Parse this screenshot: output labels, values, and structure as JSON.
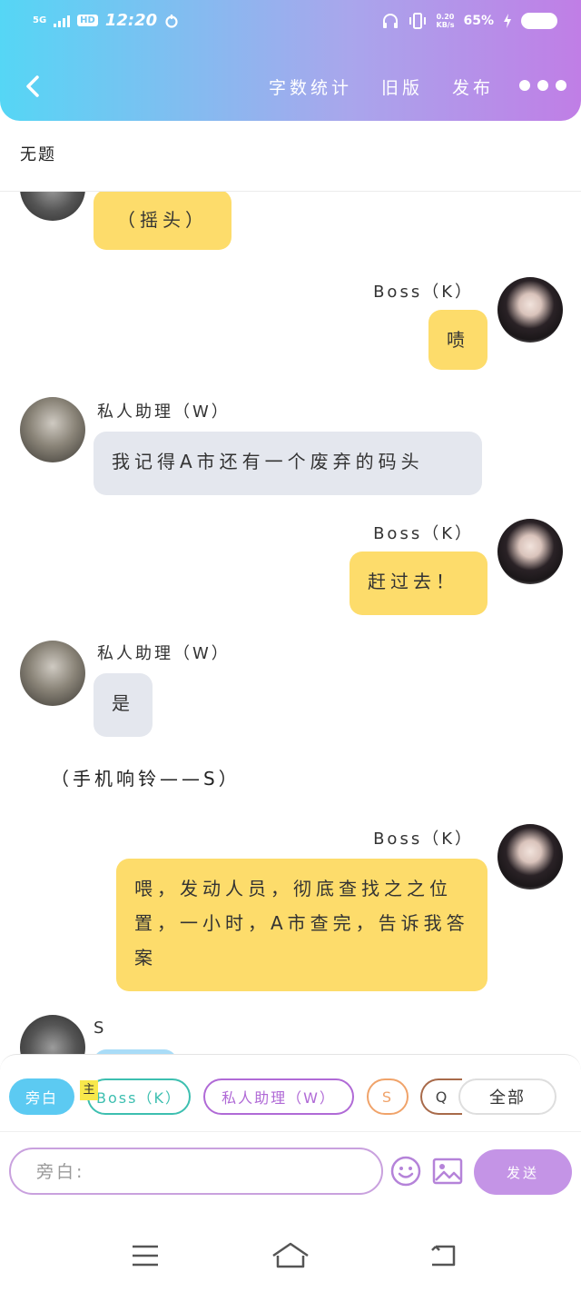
{
  "status_bar": {
    "network": "5G",
    "hd": "HD",
    "time": "12:20",
    "speed_value": "0.20",
    "speed_unit": "KB/s",
    "battery": "65%"
  },
  "header": {
    "back_icon": "chevron-left-icon",
    "word_count": "字数统计",
    "old_version": "旧版",
    "publish": "发布",
    "more_icon": "more-dots-icon"
  },
  "document": {
    "title": "无题"
  },
  "messages": [
    {
      "role": "left",
      "speaker": "",
      "text": "（摇头）",
      "bubble_color": "#fddc6b"
    },
    {
      "role": "right",
      "speaker": "Boss（K）",
      "text": "啧",
      "bubble_color": "#fddc6b"
    },
    {
      "role": "left",
      "speaker": "私人助理（W）",
      "text": "我记得A市还有一个废弃的码头",
      "bubble_color": "#e4e7ee"
    },
    {
      "role": "right",
      "speaker": "Boss（K）",
      "text": "赶过去！",
      "bubble_color": "#fddc6b"
    },
    {
      "role": "left",
      "speaker": "私人助理（W）",
      "text": "是",
      "bubble_color": "#e4e7ee"
    },
    {
      "role": "narration",
      "text": "（手机响铃——S）"
    },
    {
      "role": "right",
      "speaker": "Boss（K）",
      "text": "喂，发动人员，彻底查找之之位置，一小时，A市查完，告诉我答案",
      "bubble_color": "#fddc6b"
    },
    {
      "role": "left",
      "speaker": "S",
      "text": "",
      "bubble_color": "#a9dcf7"
    }
  ],
  "role_chips": {
    "narration": "旁白",
    "main_badge": "主",
    "boss": "Boss（K）",
    "assistant": "私人助理（W）",
    "s": "S",
    "q": "Q",
    "all": "全部"
  },
  "composer": {
    "placeholder": "旁白:",
    "emoji_icon": "emoji-smile-icon",
    "image_icon": "image-icon",
    "send_label": "发送"
  },
  "system_nav": {
    "menu_icon": "menu-icon",
    "home_icon": "home-icon",
    "back_icon": "back-icon"
  },
  "colors": {
    "header_gradient_start": "#55d6f5",
    "header_gradient_end": "#c07ee6",
    "bubble_yellow": "#fddc6b",
    "bubble_grey": "#e4e7ee",
    "accent_purple": "#c494e6",
    "chip_teal": "#3dbfb0",
    "chip_purple": "#b06ad6"
  }
}
